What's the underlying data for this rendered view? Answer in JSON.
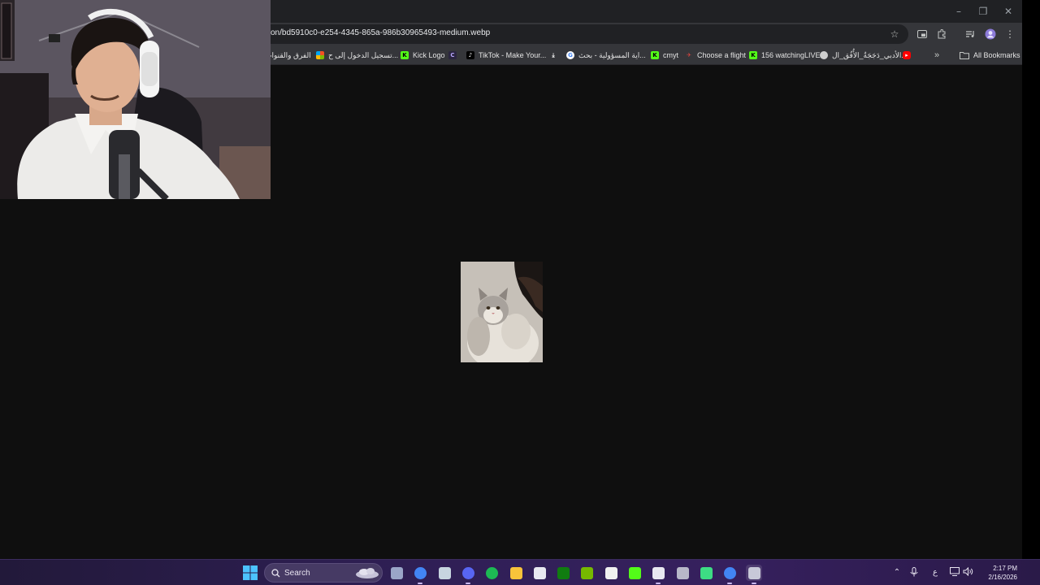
{
  "browser": {
    "url": "on/bd5910c0-e254-4345-865a-986b30965493-medium.webp",
    "window_controls": {
      "minimize": "–",
      "restore": "❐",
      "close": "✕"
    },
    "bookmarks": [
      {
        "label": "الفرق والقنوات",
        "icon_color": "#6264a7",
        "icon_name": "teams-icon"
      },
      {
        "label": "تسجيل الدخول إلى ح...",
        "icon_color": "#f25022",
        "icon_name": "microsoft-icon"
      },
      {
        "label": "Kick Logo",
        "icon_color": "#53fc18",
        "icon_name": "kick-icon"
      },
      {
        "label": "",
        "icon_color": "#7b5cff",
        "icon_name": "canva-icon"
      },
      {
        "label": "TikTok - Make Your...",
        "icon_color": "#ffffff",
        "icon_name": "tiktok-icon"
      },
      {
        "label": "",
        "icon_color": "#ffffff",
        "icon_name": "download-icon"
      },
      {
        "label": "اية المسؤولية - بحث...",
        "icon_color": "#ffffff",
        "icon_name": "google-icon"
      },
      {
        "label": "cmyt",
        "icon_color": "#53fc18",
        "icon_name": "kick-icon"
      },
      {
        "label": "Choose a flight",
        "icon_color": "#e0443e",
        "icon_name": "plane-icon"
      },
      {
        "label": "156 watchingLIVE",
        "icon_color": "#53fc18",
        "icon_name": "kick-icon"
      },
      {
        "label": "الأدبي_دَجَجَةُ_الأُفُق_ال...",
        "icon_color": "#cfcfcf",
        "icon_name": "globe-icon"
      },
      {
        "label": "",
        "icon_color": "#ff0000",
        "icon_name": "youtube-icon"
      }
    ],
    "overflow_label": "»",
    "all_bookmarks_label": "All Bookmarks"
  },
  "taskbar": {
    "search_label": "Search",
    "apps": [
      {
        "name": "camera-app-icon",
        "color": "#9aa6c8"
      },
      {
        "name": "chrome-app-icon",
        "color": "#4285f4"
      },
      {
        "name": "steam-app-icon",
        "color": "#c7d5e0"
      },
      {
        "name": "discord-app-icon",
        "color": "#5865f2"
      },
      {
        "name": "spotify-app-icon",
        "color": "#1db954"
      },
      {
        "name": "file-explorer-app-icon",
        "color": "#f8c33a"
      },
      {
        "name": "store-app-icon",
        "color": "#e8e8f0"
      },
      {
        "name": "xbox-app-icon",
        "color": "#107c10"
      },
      {
        "name": "nvidia-app-icon",
        "color": "#76b900"
      },
      {
        "name": "notepad-app-icon",
        "color": "#f0f0f0"
      },
      {
        "name": "play-app-icon",
        "color": "#53fc18"
      },
      {
        "name": "g-hub-app-icon",
        "color": "#e8e8f0"
      },
      {
        "name": "trash-app-icon",
        "color": "#b8b8c8"
      },
      {
        "name": "green-app-icon",
        "color": "#3ddc84"
      },
      {
        "name": "chrome-profile-app-icon",
        "color": "#4285f4"
      },
      {
        "name": "settings-app-icon",
        "color": "#c8c8d8"
      }
    ],
    "tray": {
      "language": "ع",
      "time": "2:17 PM",
      "date": "2/16/2026"
    }
  }
}
